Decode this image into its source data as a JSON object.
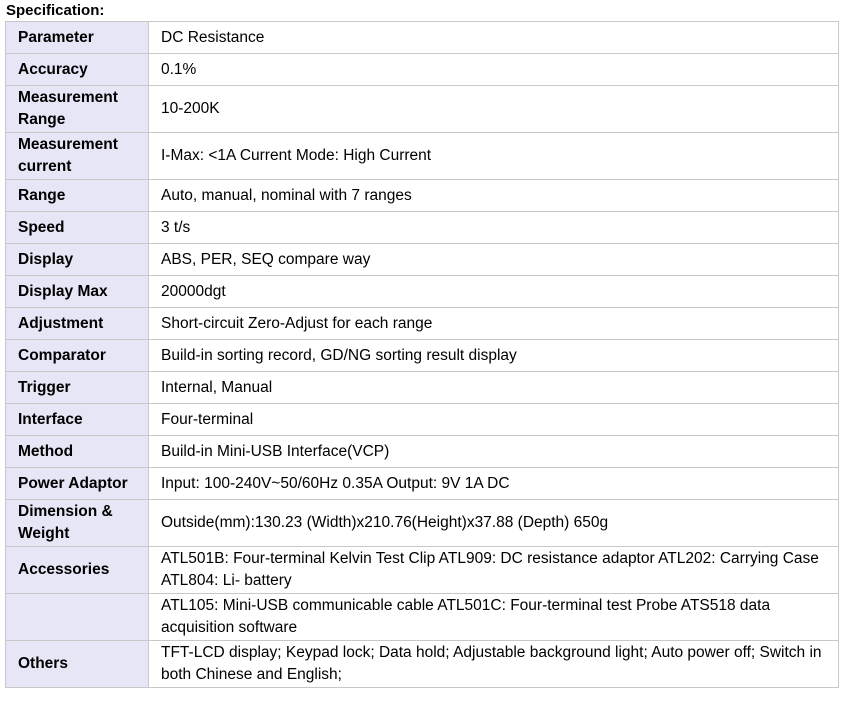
{
  "title": "Specification:",
  "rows": [
    {
      "param": "Parameter",
      "value": "DC Resistance"
    },
    {
      "param": "Accuracy",
      "value": "0.1%"
    },
    {
      "param": "Measurement Range",
      "value": "10-200K"
    },
    {
      "param": "Measurement current",
      "value": "I-Max: <1A Current Mode: High Current"
    },
    {
      "param": "Range",
      "value": "Auto, manual, nominal with 7 ranges"
    },
    {
      "param": "Speed",
      "value": "3 t/s"
    },
    {
      "param": "Display",
      "value": "ABS, PER, SEQ compare way"
    },
    {
      "param": "Display Max",
      "value": "20000dgt"
    },
    {
      "param": "Adjustment",
      "value": "Short-circuit Zero-Adjust for each range"
    },
    {
      "param": "Comparator",
      "value": "Build-in sorting record, GD/NG sorting result display"
    },
    {
      "param": "Trigger",
      "value": "Internal, Manual"
    },
    {
      "param": "Interface",
      "value": "Four-terminal"
    },
    {
      "param": "Method",
      "value": "Build-in Mini-USB Interface(VCP)"
    },
    {
      "param": "Power Adaptor",
      "value": "Input: 100-240V~50/60Hz 0.35A Output: 9V 1A DC"
    },
    {
      "param": "Dimension & Weight",
      "value": "Outside(mm):130.23 (Width)x210.76(Height)x37.88 (Depth) 650g"
    },
    {
      "param": "Accessories",
      "value": "ATL501B: Four-terminal Kelvin Test Clip ATL909: DC resistance adaptor ATL202: Carrying Case ATL804: Li- battery"
    },
    {
      "param": "",
      "value": "ATL105: Mini-USB communicable cable ATL501C: Four-terminal test Probe ATS518 data acquisition software"
    },
    {
      "param": "Others",
      "value": "TFT-LCD display; Keypad lock; Data hold; Adjustable background light; Auto power off; Switch in both Chinese and English;"
    }
  ]
}
